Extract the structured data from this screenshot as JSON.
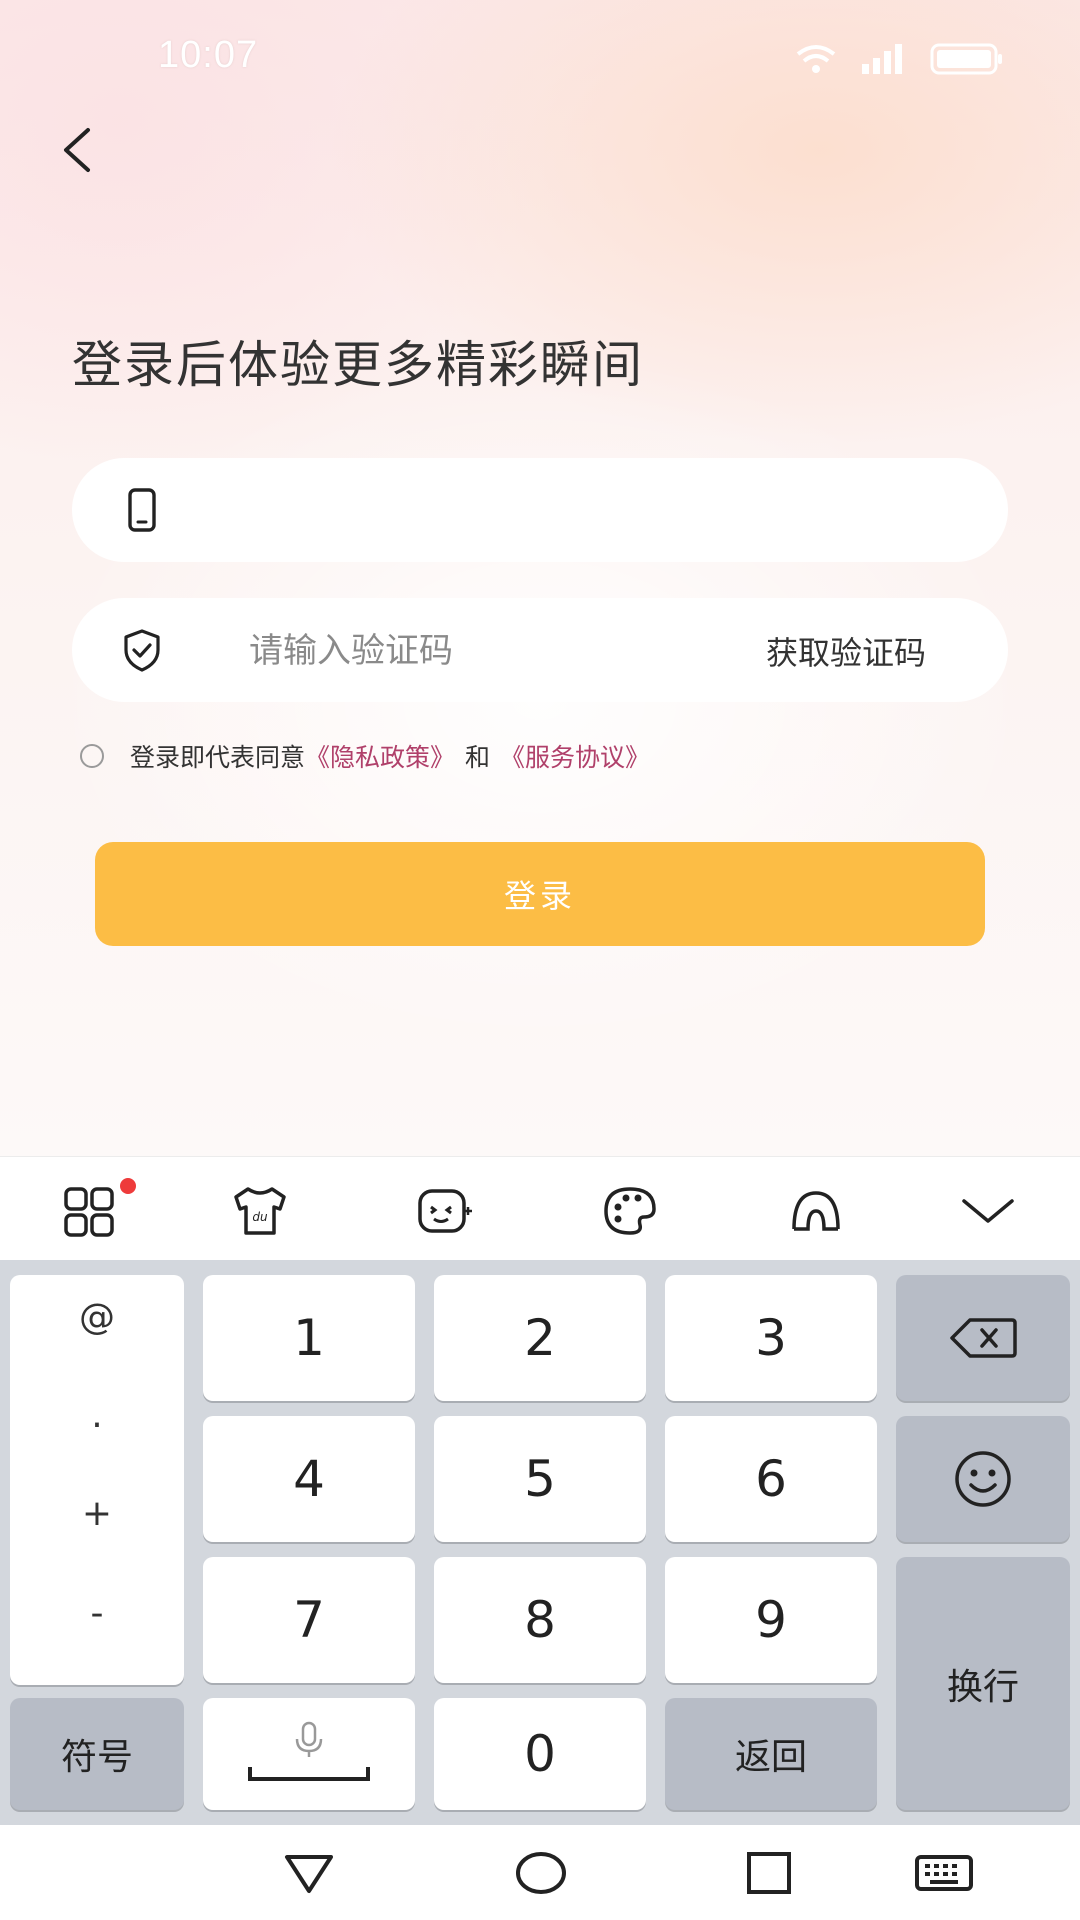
{
  "status_bar": {
    "time": "10:07"
  },
  "headline": "登录后体验更多精彩瞬间",
  "phone_field": {
    "value": "",
    "placeholder": ""
  },
  "code_field": {
    "placeholder": "请输入验证码",
    "get_code_label": "获取验证码"
  },
  "agreement": {
    "prefix": "登录即代表同意",
    "privacy_link": "《隐私政策》",
    "and": "和",
    "service_link": "《服务协议》",
    "link_color": "#b0406a"
  },
  "login_button": {
    "label": "登录",
    "color": "#fcbd45"
  },
  "keyboard": {
    "symbols": [
      "@",
      ".",
      "+",
      "-"
    ],
    "keys": {
      "k1": "1",
      "k2": "2",
      "k3": "3",
      "k4": "4",
      "k5": "5",
      "k6": "6",
      "k7": "7",
      "k8": "8",
      "k9": "9",
      "k0": "0"
    },
    "symbol_key": "符号",
    "back_key": "返回",
    "enter_key": "换行",
    "toolbar_icons": [
      "apps-grid-icon",
      "skin-shirt-icon",
      "emoji-face-icon",
      "palette-icon",
      "handwriting-icon",
      "collapse-chevron-icon"
    ]
  },
  "nav_bar": {
    "icons": [
      "back-triangle-icon",
      "home-circle-icon",
      "recents-square-icon",
      "keyboard-switch-icon"
    ]
  }
}
